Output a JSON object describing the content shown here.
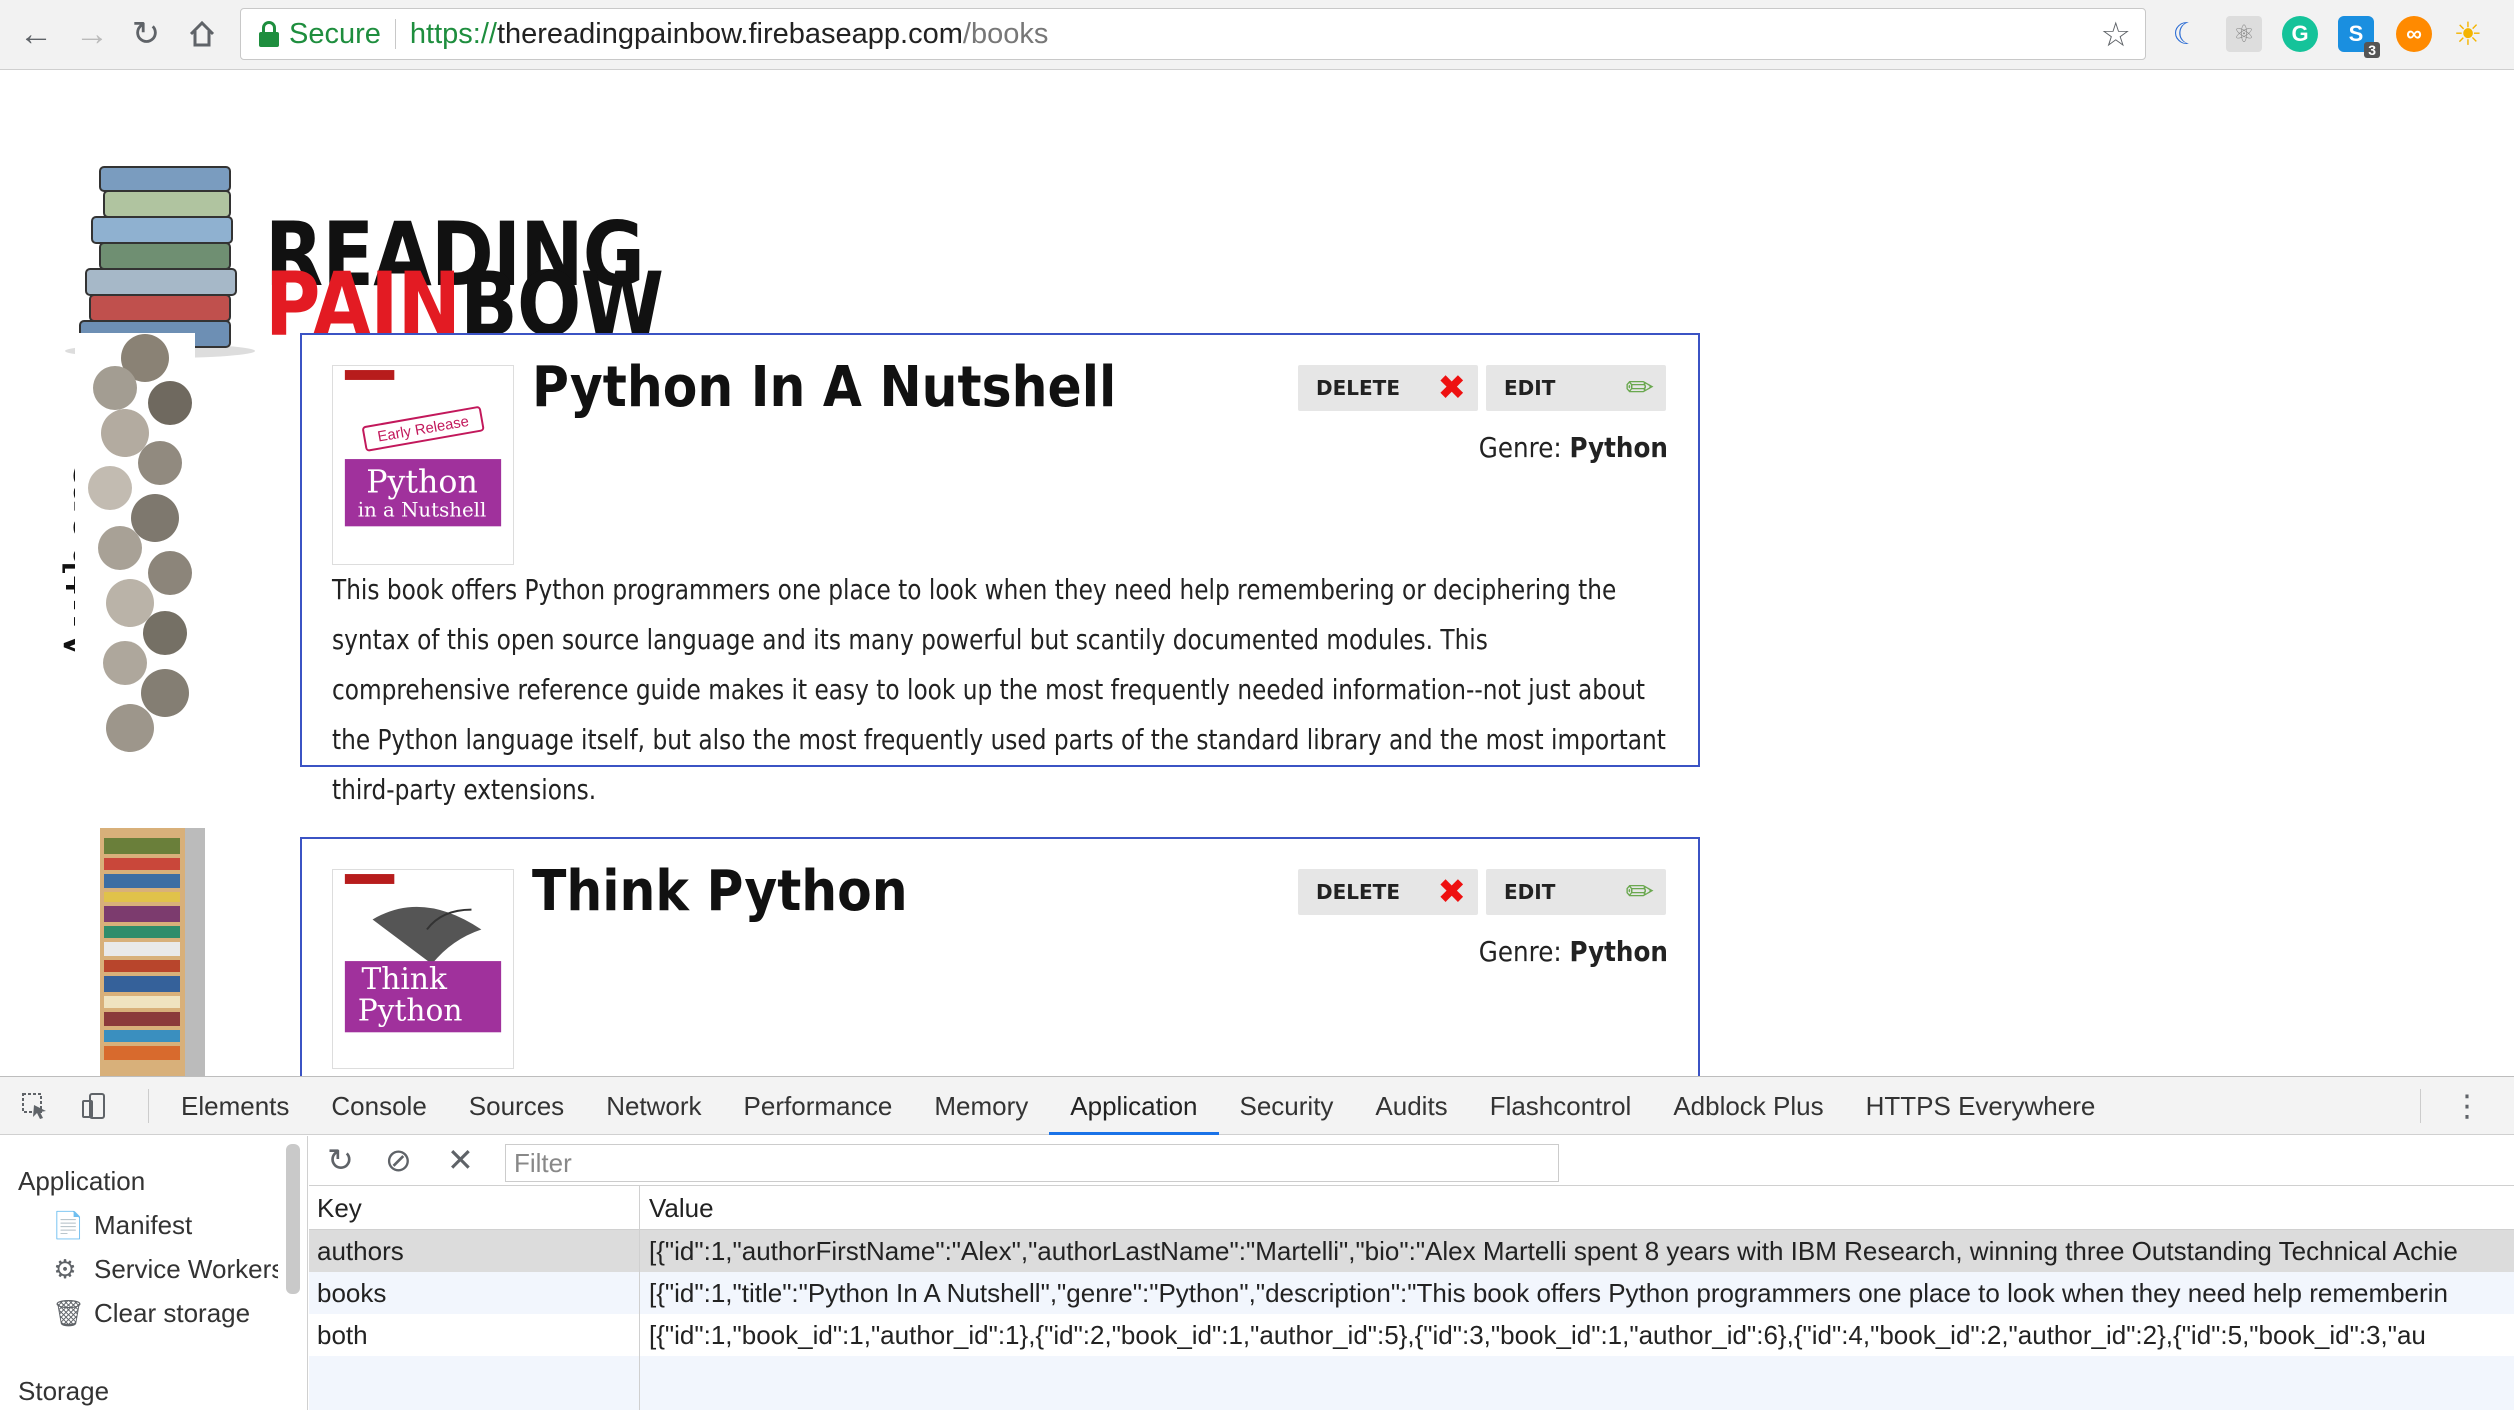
{
  "browser": {
    "secure_label": "Secure",
    "url_scheme": "https://",
    "url_host": "thereadingpainbow.firebaseapp.com",
    "url_path": "/books",
    "extension_badge": "3"
  },
  "site": {
    "logo_line1": "READING",
    "logo_line2_red": "PAIN",
    "logo_line2_black": "BOW",
    "authors_label": "Authors",
    "accent_red": "#e31b23",
    "card_border": "#3b53c4"
  },
  "books": [
    {
      "title": "Python In A Nutshell",
      "delete_label": "DELETE",
      "edit_label": "EDIT",
      "genre_label": "Genre:",
      "genre": "Python",
      "cover_badge": "Early Release",
      "cover_title1": "Python",
      "cover_title2": "in a Nutshell",
      "description": "This book offers Python programmers one place to look when they need help remembering or deciphering the syntax of this open source language and its many powerful but scantily documented modules. This comprehensive reference guide makes it easy to look up the most frequently needed information--not just about the Python language itself, but also the most frequently used parts of the standard library and the most important third-party extensions."
    },
    {
      "title": "Think Python",
      "delete_label": "DELETE",
      "edit_label": "EDIT",
      "genre_label": "Genre:",
      "genre": "Python",
      "cover_title1": "Think",
      "cover_title2": "Python"
    }
  ],
  "devtools": {
    "tabs": [
      "Elements",
      "Console",
      "Sources",
      "Network",
      "Performance",
      "Memory",
      "Application",
      "Security",
      "Audits",
      "Flashcontrol",
      "Adblock Plus",
      "HTTPS Everywhere"
    ],
    "active_tab": "Application",
    "sidebar": {
      "title": "Application",
      "items": [
        "Manifest",
        "Service Workers",
        "Clear storage"
      ],
      "storage_title": "Storage"
    },
    "filter_placeholder": "Filter",
    "table": {
      "key_header": "Key",
      "value_header": "Value",
      "rows": [
        {
          "key": "authors",
          "value": "[{\"id\":1,\"authorFirstName\":\"Alex\",\"authorLastName\":\"Martelli\",\"bio\":\"Alex Martelli spent 8 years with IBM Research, winning three Outstanding Technical Achie"
        },
        {
          "key": "books",
          "value": "[{\"id\":1,\"title\":\"Python In A Nutshell\",\"genre\":\"Python\",\"description\":\"This book offers Python programmers one place to look when they need help rememberin"
        },
        {
          "key": "both",
          "value": "[{\"id\":1,\"book_id\":1,\"author_id\":1},{\"id\":2,\"book_id\":1,\"author_id\":5},{\"id\":3,\"book_id\":1,\"author_id\":6},{\"id\":4,\"book_id\":2,\"author_id\":2},{\"id\":5,\"book_id\":3,\"au"
        }
      ]
    }
  }
}
